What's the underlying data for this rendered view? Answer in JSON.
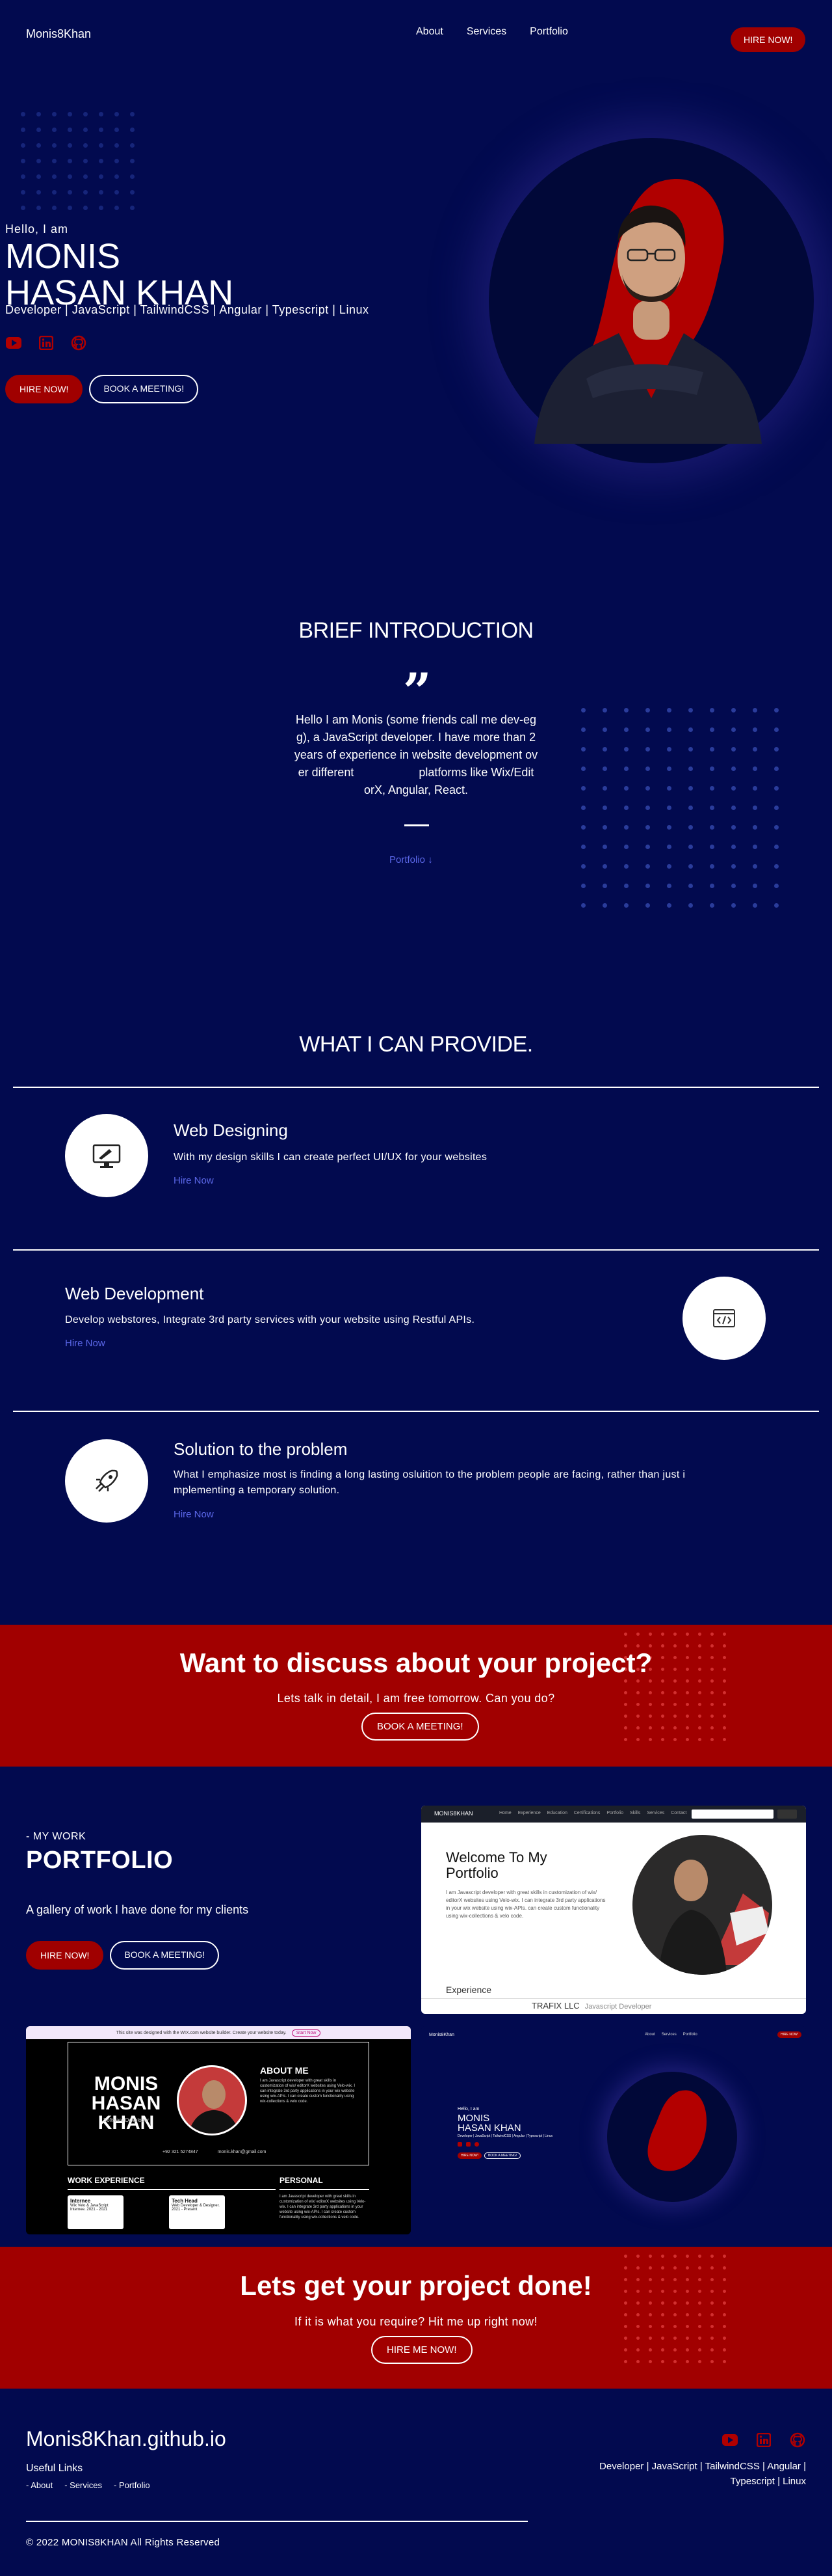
{
  "nav": {
    "brand": "Monis8Khan",
    "links": [
      "About",
      "Services",
      "Portfolio"
    ],
    "hire": "HIRE NOW!"
  },
  "hero": {
    "hello": "Hello, I am",
    "name_line1": "MONIS",
    "name_line2": "HASAN KHAN",
    "skills": "Developer | JavaScript | TailwindCSS | Angular | Typescript | Linux",
    "social_icons": [
      "youtube-icon",
      "linkedin-icon",
      "github-icon"
    ],
    "hire": "HIRE NOW!",
    "meeting": "BOOK A MEETING!"
  },
  "intro": {
    "title": "BRIEF INTRODUCTION",
    "quote": "”",
    "lines": [
      "Hello I am Monis (some friends call me dev-eg",
      "g), a JavaScript developer. I have more than 2",
      "years of experience in website development ov",
      "er different                    platforms like Wix/Edit",
      "orX, Angular, React."
    ],
    "link": "Portfolio"
  },
  "services": {
    "title": "WHAT I CAN PROVIDE.",
    "items": [
      {
        "title": "Web Designing",
        "desc": "With my design skills I can create perfect UI/UX for your websites",
        "link": "Hire Now",
        "icon": "monitor-design-icon"
      },
      {
        "title": "Web Development",
        "desc": "Develop webstores, Integrate 3rd party services with your website using Restful APIs.",
        "link": "Hire Now",
        "icon": "code-window-icon"
      },
      {
        "title": "Solution to the problem",
        "desc_line1": "What I emphasize most is finding a long lasting osluition to the problem people are facing, rather than just i",
        "desc_line2": "mplementing a temporary solution.",
        "link": "Hire Now",
        "icon": "rocket-icon"
      }
    ]
  },
  "cta1": {
    "title": "Want to discuss about your project?",
    "sub": "Lets talk in detail, I am free tomorrow. Can you do?",
    "button": "BOOK A MEETING!"
  },
  "portfolio": {
    "kicker": "- MY WORK",
    "title": "PORTFOLIO",
    "desc": "A gallery of work I have done for my clients",
    "hire": "HIRE NOW!",
    "meeting": "BOOK A MEETING!",
    "shot1": {
      "brand": "MONIS8KHAN",
      "menu": [
        "Home",
        "Experience",
        "Education",
        "Certifications",
        "Portfolio",
        "Skills",
        "Services",
        "Contact"
      ],
      "heading_line1": "Welcome To My",
      "heading_line2": "Portfolio",
      "body": "I am Javascript developer with great skills in customization of wix/ editorX websites using Velo-wix. I can integrate 3rd party applications in your wix website using wix-APIs. can create custom functionality using wix-collections & velo code.",
      "experience": "Experience",
      "company": "TRAFIX LLC",
      "role": "Javascript Developer"
    },
    "shot2": {
      "banner": "This site was designed with the WIX.com website builder. Create your website today.",
      "banner_btn": "Start Now",
      "name1": "MONIS",
      "name2": "HASAN KHAN",
      "role": "Software Developer",
      "about": "ABOUT ME",
      "about_text": "I am Javascript developer with great skills in customization of wix/ editorX websites using Velo-wix. I can integrate 3rd party applications in your wix website using wix-APIs. I can create custom functionality using wix-collections & velo code.",
      "phone": "+92 321 5274847",
      "email": "monis.khan@gmail.com",
      "work": "WORK EXPERIENCE",
      "personal": "PERSONAL",
      "card1_title": "Internee",
      "card1_text": "Wix Velo & JavaScript Internee. 2021 - 2021",
      "card2_title": "Tech Head",
      "card2_text": "Web Developer & Designer. 2021 - Present",
      "personal_text": "I am Javascript developer with great skills in customization of wix/ editorX websites using Velo-wix. I can integrate 3rd party applications in your website using wix-APIs. I can create custom functionality using wix-collections & velo code."
    },
    "shot3": {
      "brand": "Monis8Khan",
      "menu": [
        "About",
        "Services",
        "Portfolio"
      ],
      "hire": "HIRE NOW!",
      "hello": "Hello, I am",
      "name1": "MONIS",
      "name2": "HASAN KHAN",
      "skills": "Developer | JavaScript | TailwindCSS | Angular | Typescript | Linux",
      "btn1": "HIRE NOW!",
      "btn2": "BOOK A MEETING!"
    }
  },
  "cta2": {
    "title": "Lets get your project done!",
    "sub": "If it is what you require? Hit me up right now!",
    "button": "HIRE ME NOW!"
  },
  "footer": {
    "title": "Monis8Khan.github.io",
    "useful": "Useful Links",
    "links": [
      "- About",
      "- Services",
      "- Portfolio"
    ],
    "skills_line1": "Developer | JavaScript | TailwindCSS | Angular |",
    "skills_line2": "Typescript | Linux",
    "copyright": "© 2022 MONIS8KHAN All Rights Reserved",
    "social_icons": [
      "youtube-icon",
      "linkedin-icon",
      "github-icon"
    ]
  },
  "colors": {
    "background": "#020a4f",
    "accent_red": "#a00000",
    "link_blue": "#5b67e8",
    "dot_blue": "#2a3c9b"
  }
}
